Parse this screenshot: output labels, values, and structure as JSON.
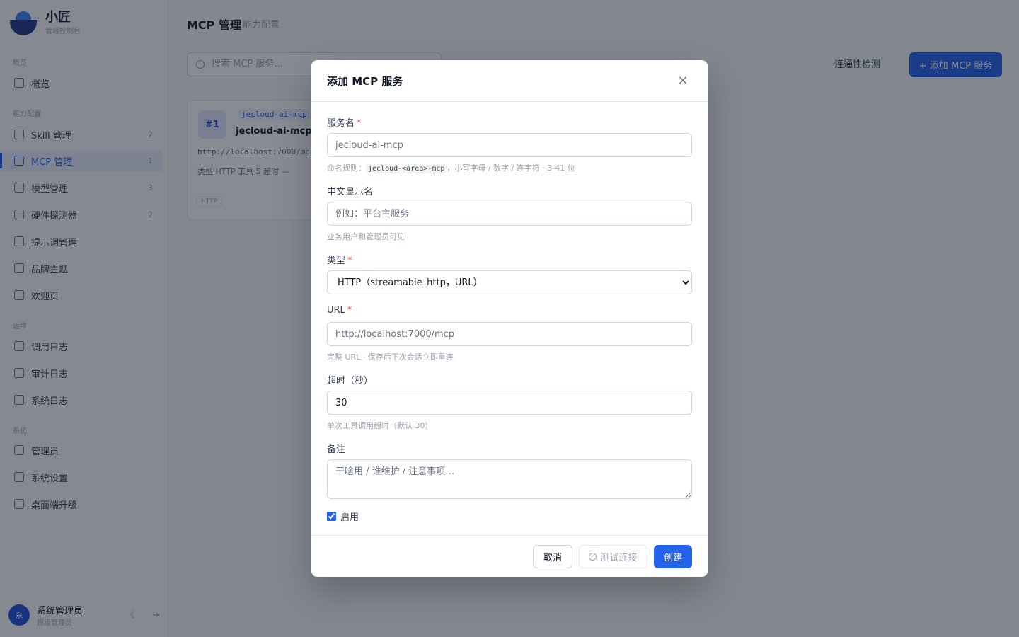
{
  "sidebar": {
    "brand_name": "小匠",
    "brand_sub": "管理控制台",
    "groups": {
      "g0": "概览",
      "g1": "能力配置",
      "g2": "运维",
      "g3": "系统"
    },
    "items": [
      {
        "label": "概览",
        "count": ""
      },
      {
        "label": "Skill 管理",
        "count": "2"
      },
      {
        "label": "MCP 管理",
        "count": "1"
      },
      {
        "label": "模型管理",
        "count": "3"
      },
      {
        "label": "硬件探测器",
        "count": "2"
      },
      {
        "label": "提示词管理",
        "count": ""
      },
      {
        "label": "品牌主题",
        "count": ""
      },
      {
        "label": "欢迎页",
        "count": ""
      },
      {
        "label": "调用日志",
        "count": ""
      },
      {
        "label": "审计日志",
        "count": ""
      },
      {
        "label": "系统日志",
        "count": ""
      },
      {
        "label": "管理员",
        "count": ""
      },
      {
        "label": "系统设置",
        "count": ""
      },
      {
        "label": "桌面端升级",
        "count": ""
      }
    ],
    "user": {
      "avatar": "系",
      "name": "系统管理员",
      "role": "超级管理员"
    }
  },
  "main": {
    "title": "MCP 管理",
    "subtitle": "能力配置",
    "search_placeholder": "搜索 MCP 服务...",
    "plain_btn": "连通性检测",
    "add_btn": "+ 添加 MCP 服务",
    "card": {
      "badge": "#1",
      "slug": "jecloud-ai-mcp",
      "name": "jecloud-ai-mcp",
      "url": "http://localhost:7000/mcp",
      "meta": "类型 HTTP   工具 5   超时 —",
      "tag": "HTTP"
    }
  },
  "modal": {
    "title": "添加 MCP 服务",
    "close_glyph": "×",
    "name_field": {
      "label": "服务名",
      "required": "*",
      "placeholder": "jecloud-ai-mcp",
      "help_prefix": "命名规则：",
      "help_code": "jecloud-<area>-mcp",
      "help_suffix": "，小写字母 / 数字 / 连字符 · 3-41 位"
    },
    "display_field": {
      "label": "中文显示名",
      "placeholder": "例如：平台主服务",
      "help": "业务用户和管理员可见"
    },
    "type_field": {
      "label": "类型",
      "required": "*",
      "selected": "HTTP（streamable_http，URL）"
    },
    "url_field": {
      "label": "URL",
      "required": "*",
      "placeholder": "http://localhost:7000/mcp",
      "help": "完整 URL · 保存后下次会话立即重连"
    },
    "timeout_field": {
      "label": "超时（秒）",
      "value": "30",
      "help": "单次工具调用超时（默认 30）"
    },
    "notes_field": {
      "label": "备注",
      "placeholder": "干啥用 / 谁维护 / 注意事项…"
    },
    "enabled_label": "启用",
    "cancel_btn": "取消",
    "test_btn": "测试连接",
    "create_btn": "创建",
    "accent": "#2563eb"
  }
}
